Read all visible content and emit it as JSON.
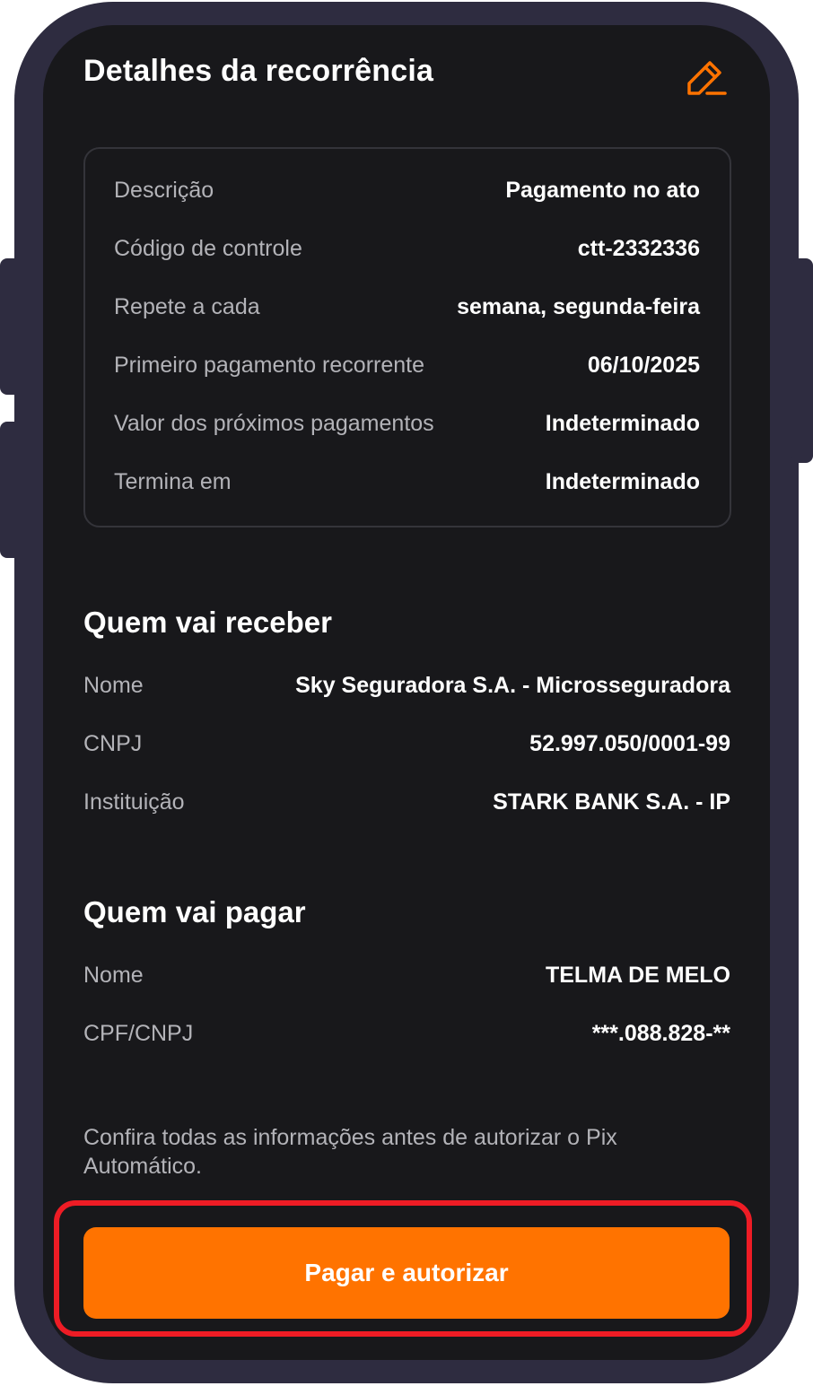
{
  "header": {
    "title": "Detalhes da recorrência",
    "edit_icon": "pencil-icon",
    "accent_color": "#ff7300"
  },
  "recurrence": {
    "rows": [
      {
        "label": "Descrição",
        "value": "Pagamento no ato"
      },
      {
        "label": "Código de controle",
        "value": "ctt-2332336"
      },
      {
        "label": "Repete a cada",
        "value": "semana, segunda-feira"
      },
      {
        "label": "Primeiro pagamento recorrente",
        "value": "06/10/2025"
      },
      {
        "label": "Valor dos próximos pagamentos",
        "value": "Indeterminado"
      },
      {
        "label": "Termina em",
        "value": "Indeterminado"
      }
    ]
  },
  "receiver": {
    "title": "Quem vai receber",
    "rows": [
      {
        "label": "Nome",
        "value": "Sky Seguradora S.A. - Microsseguradora"
      },
      {
        "label": "CNPJ",
        "value": "52.997.050/0001-99"
      },
      {
        "label": "Instituição",
        "value": "STARK BANK S.A. - IP"
      }
    ]
  },
  "payer": {
    "title": "Quem vai pagar",
    "rows": [
      {
        "label": "Nome",
        "value": "TELMA DE MELO"
      },
      {
        "label": "CPF/CNPJ",
        "value": "***.088.828-**"
      }
    ]
  },
  "note": "Confira todas as informações antes de autorizar o Pix Automático.",
  "action": {
    "label": "Pagar e autorizar",
    "highlight_color": "#ee1c25"
  }
}
